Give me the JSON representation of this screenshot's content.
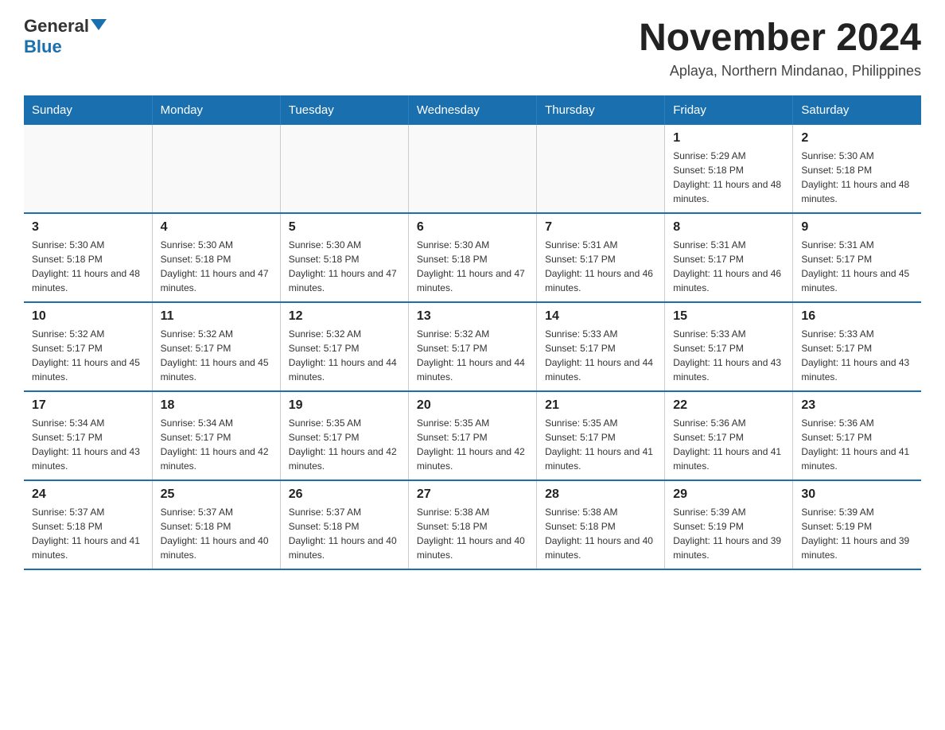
{
  "logo": {
    "general": "General",
    "blue": "Blue"
  },
  "header": {
    "month_title": "November 2024",
    "subtitle": "Aplaya, Northern Mindanao, Philippines"
  },
  "days_of_week": [
    "Sunday",
    "Monday",
    "Tuesday",
    "Wednesday",
    "Thursday",
    "Friday",
    "Saturday"
  ],
  "weeks": [
    [
      {
        "day": "",
        "info": ""
      },
      {
        "day": "",
        "info": ""
      },
      {
        "day": "",
        "info": ""
      },
      {
        "day": "",
        "info": ""
      },
      {
        "day": "",
        "info": ""
      },
      {
        "day": "1",
        "info": "Sunrise: 5:29 AM\nSunset: 5:18 PM\nDaylight: 11 hours and 48 minutes."
      },
      {
        "day": "2",
        "info": "Sunrise: 5:30 AM\nSunset: 5:18 PM\nDaylight: 11 hours and 48 minutes."
      }
    ],
    [
      {
        "day": "3",
        "info": "Sunrise: 5:30 AM\nSunset: 5:18 PM\nDaylight: 11 hours and 48 minutes."
      },
      {
        "day": "4",
        "info": "Sunrise: 5:30 AM\nSunset: 5:18 PM\nDaylight: 11 hours and 47 minutes."
      },
      {
        "day": "5",
        "info": "Sunrise: 5:30 AM\nSunset: 5:18 PM\nDaylight: 11 hours and 47 minutes."
      },
      {
        "day": "6",
        "info": "Sunrise: 5:30 AM\nSunset: 5:18 PM\nDaylight: 11 hours and 47 minutes."
      },
      {
        "day": "7",
        "info": "Sunrise: 5:31 AM\nSunset: 5:17 PM\nDaylight: 11 hours and 46 minutes."
      },
      {
        "day": "8",
        "info": "Sunrise: 5:31 AM\nSunset: 5:17 PM\nDaylight: 11 hours and 46 minutes."
      },
      {
        "day": "9",
        "info": "Sunrise: 5:31 AM\nSunset: 5:17 PM\nDaylight: 11 hours and 45 minutes."
      }
    ],
    [
      {
        "day": "10",
        "info": "Sunrise: 5:32 AM\nSunset: 5:17 PM\nDaylight: 11 hours and 45 minutes."
      },
      {
        "day": "11",
        "info": "Sunrise: 5:32 AM\nSunset: 5:17 PM\nDaylight: 11 hours and 45 minutes."
      },
      {
        "day": "12",
        "info": "Sunrise: 5:32 AM\nSunset: 5:17 PM\nDaylight: 11 hours and 44 minutes."
      },
      {
        "day": "13",
        "info": "Sunrise: 5:32 AM\nSunset: 5:17 PM\nDaylight: 11 hours and 44 minutes."
      },
      {
        "day": "14",
        "info": "Sunrise: 5:33 AM\nSunset: 5:17 PM\nDaylight: 11 hours and 44 minutes."
      },
      {
        "day": "15",
        "info": "Sunrise: 5:33 AM\nSunset: 5:17 PM\nDaylight: 11 hours and 43 minutes."
      },
      {
        "day": "16",
        "info": "Sunrise: 5:33 AM\nSunset: 5:17 PM\nDaylight: 11 hours and 43 minutes."
      }
    ],
    [
      {
        "day": "17",
        "info": "Sunrise: 5:34 AM\nSunset: 5:17 PM\nDaylight: 11 hours and 43 minutes."
      },
      {
        "day": "18",
        "info": "Sunrise: 5:34 AM\nSunset: 5:17 PM\nDaylight: 11 hours and 42 minutes."
      },
      {
        "day": "19",
        "info": "Sunrise: 5:35 AM\nSunset: 5:17 PM\nDaylight: 11 hours and 42 minutes."
      },
      {
        "day": "20",
        "info": "Sunrise: 5:35 AM\nSunset: 5:17 PM\nDaylight: 11 hours and 42 minutes."
      },
      {
        "day": "21",
        "info": "Sunrise: 5:35 AM\nSunset: 5:17 PM\nDaylight: 11 hours and 41 minutes."
      },
      {
        "day": "22",
        "info": "Sunrise: 5:36 AM\nSunset: 5:17 PM\nDaylight: 11 hours and 41 minutes."
      },
      {
        "day": "23",
        "info": "Sunrise: 5:36 AM\nSunset: 5:17 PM\nDaylight: 11 hours and 41 minutes."
      }
    ],
    [
      {
        "day": "24",
        "info": "Sunrise: 5:37 AM\nSunset: 5:18 PM\nDaylight: 11 hours and 41 minutes."
      },
      {
        "day": "25",
        "info": "Sunrise: 5:37 AM\nSunset: 5:18 PM\nDaylight: 11 hours and 40 minutes."
      },
      {
        "day": "26",
        "info": "Sunrise: 5:37 AM\nSunset: 5:18 PM\nDaylight: 11 hours and 40 minutes."
      },
      {
        "day": "27",
        "info": "Sunrise: 5:38 AM\nSunset: 5:18 PM\nDaylight: 11 hours and 40 minutes."
      },
      {
        "day": "28",
        "info": "Sunrise: 5:38 AM\nSunset: 5:18 PM\nDaylight: 11 hours and 40 minutes."
      },
      {
        "day": "29",
        "info": "Sunrise: 5:39 AM\nSunset: 5:19 PM\nDaylight: 11 hours and 39 minutes."
      },
      {
        "day": "30",
        "info": "Sunrise: 5:39 AM\nSunset: 5:19 PM\nDaylight: 11 hours and 39 minutes."
      }
    ]
  ]
}
